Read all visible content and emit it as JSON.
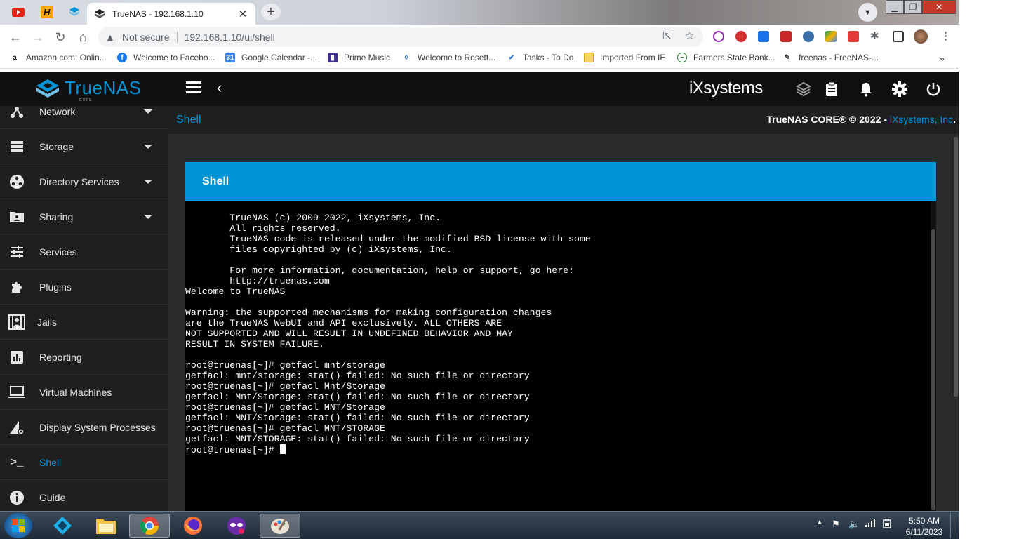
{
  "browser": {
    "tab_title": "TrueNAS - 192.168.1.10",
    "security_label": "Not secure",
    "url": "192.168.1.10/ui/shell",
    "bookmarks": [
      "Amazon.com: Onlin...",
      "Welcome to Facebo...",
      "Google Calendar -...",
      "Prime Music",
      "Welcome to Rosett...",
      "Tasks - To Do",
      "Imported From IE",
      "Farmers State Bank...",
      "freenas - FreeNAS-..."
    ],
    "bookmarks_overflow": "»"
  },
  "app": {
    "logo_text": "TrueNAS",
    "logo_sub": "CORE",
    "vendor_logo": "iXsystems"
  },
  "sidebar": {
    "items": [
      {
        "label": "Network",
        "icon": "network-icon"
      },
      {
        "label": "Storage",
        "icon": "storage-icon"
      },
      {
        "label": "Directory Services",
        "icon": "directory-services-icon"
      },
      {
        "label": "Sharing",
        "icon": "sharing-icon"
      },
      {
        "label": "Services",
        "icon": "services-icon"
      },
      {
        "label": "Plugins",
        "icon": "plugins-icon"
      },
      {
        "label": "Jails",
        "icon": "jails-icon"
      },
      {
        "label": "Reporting",
        "icon": "reporting-icon"
      },
      {
        "label": "Virtual Machines",
        "icon": "virtual-machines-icon"
      },
      {
        "label": "Display System Processes",
        "icon": "processes-icon"
      },
      {
        "label": "Shell",
        "icon": "shell-icon"
      },
      {
        "label": "Guide",
        "icon": "guide-icon"
      }
    ],
    "active": "Shell"
  },
  "breadcrumb": "Shell",
  "copyright": {
    "text": "TrueNAS CORE® © 2022 - ",
    "company": "iXsystems, Inc",
    "end": "."
  },
  "card": {
    "title": "Shell"
  },
  "terminal": {
    "lines": [
      "        TrueNAS (c) 2009-2022, iXsystems, Inc.",
      "        All rights reserved.",
      "        TrueNAS code is released under the modified BSD license with some",
      "        files copyrighted by (c) iXsystems, Inc.",
      "",
      "        For more information, documentation, help or support, go here:",
      "        http://truenas.com",
      "Welcome to TrueNAS",
      "",
      "Warning: the supported mechanisms for making configuration changes",
      "are the TrueNAS WebUI and API exclusively. ALL OTHERS ARE",
      "NOT SUPPORTED AND WILL RESULT IN UNDEFINED BEHAVIOR AND MAY",
      "RESULT IN SYSTEM FAILURE.",
      "",
      "root@truenas[~]# getfacl mnt/storage",
      "getfacl: mnt/storage: stat() failed: No such file or directory",
      "root@truenas[~]# getfacl Mnt/Storage",
      "getfacl: Mnt/Storage: stat() failed: No such file or directory",
      "root@truenas[~]# getfacl MNT/Storage",
      "getfacl: MNT/Storage: stat() failed: No such file or directory",
      "root@truenas[~]# getfacl MNT/STORAGE",
      "getfacl: MNT/STORAGE: stat() failed: No such file or directory"
    ],
    "prompt": "root@truenas[~]# "
  },
  "taskbar": {
    "time": "5:50 AM",
    "date": "6/11/2023"
  },
  "colors": {
    "accent": "#0095d5",
    "sidebar_bg": "#1f1f1f",
    "topbar_bg": "#101010",
    "terminal_bg": "#000000"
  }
}
